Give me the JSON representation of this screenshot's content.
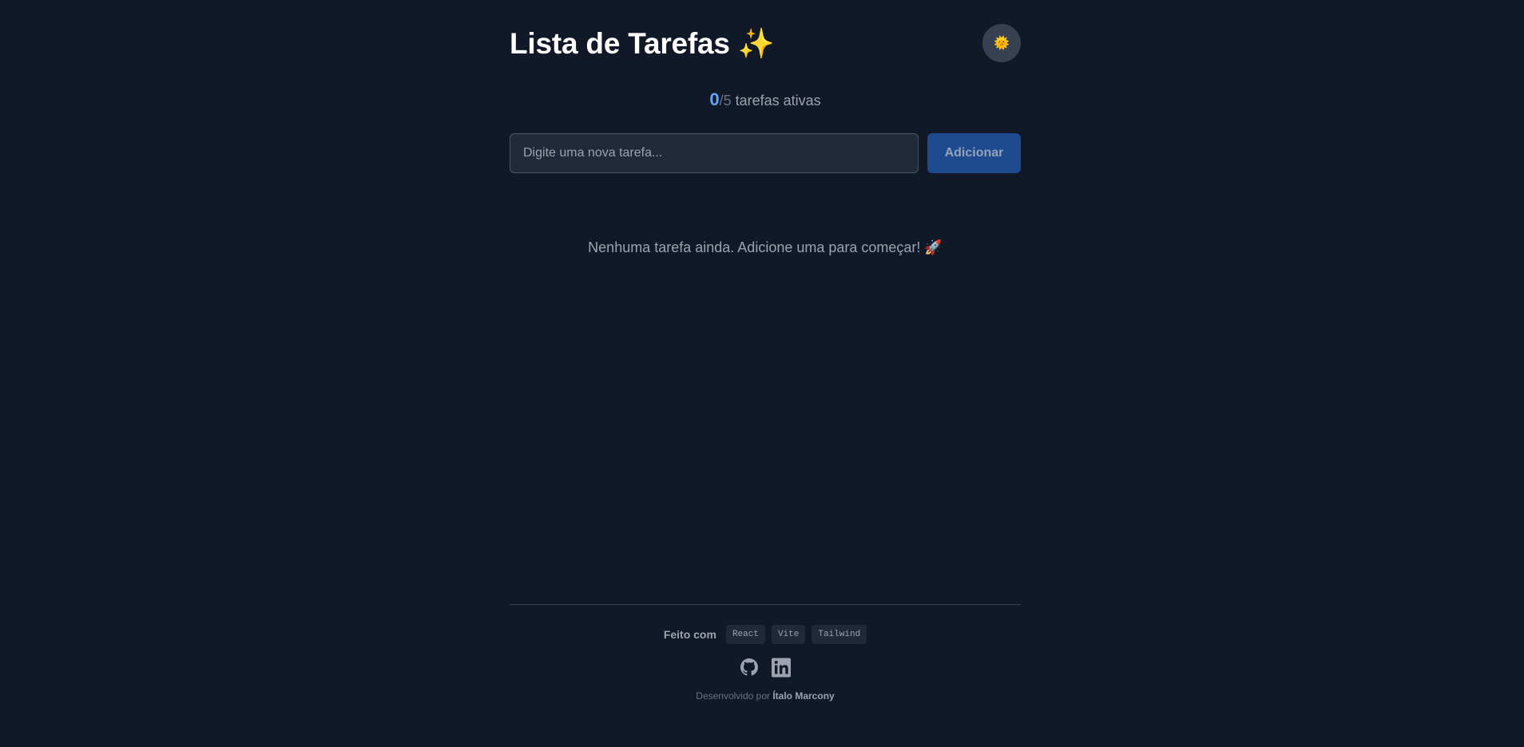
{
  "header": {
    "title": "Lista de Tarefas ✨",
    "theme_toggle_icon": "sun-icon",
    "theme_toggle_glyph": "🌞"
  },
  "counter": {
    "active": "0",
    "total": "/5",
    "label": " tarefas ativas"
  },
  "task_form": {
    "input_placeholder": "Digite uma nova tarefa...",
    "input_value": "",
    "add_label": "Adicionar"
  },
  "empty_state": {
    "message": "Nenhuma tarefa ainda. Adicione uma para começar! 🚀"
  },
  "footer": {
    "made_with_label": "Feito com",
    "technologies": [
      "React",
      "Vite",
      "Tailwind"
    ],
    "social_icons": [
      "github-icon",
      "linkedin-icon"
    ],
    "credit_prefix": "Desenvolvido por ",
    "author": "Ítalo Marcony"
  },
  "colors": {
    "background": "#111827",
    "accent": "#60a5fa",
    "button": "#1e4a8f",
    "input_bg": "#1f2937"
  }
}
